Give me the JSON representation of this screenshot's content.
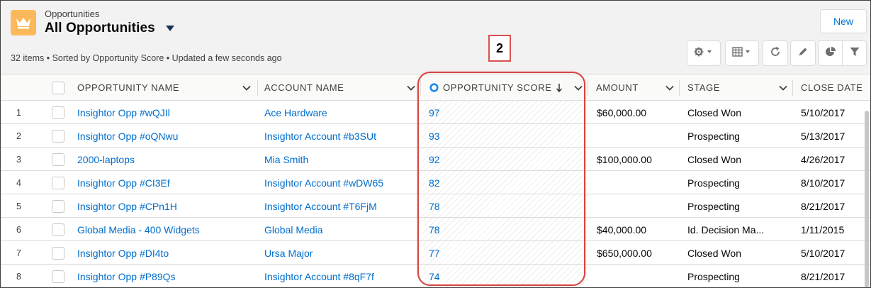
{
  "header": {
    "object_label": "Opportunities",
    "list_title": "All Opportunities",
    "new_button": "New",
    "meta": "32 items • Sorted by Opportunity Score • Updated a few seconds ago",
    "callout": "2"
  },
  "toolbar": {
    "icons": [
      "gear-icon",
      "table-icon",
      "refresh-icon",
      "pencil-icon",
      "pie-chart-icon",
      "filter-icon"
    ]
  },
  "columns": {
    "name": "Opportunity Name",
    "account": "Account Name",
    "score": "Opportunity Score",
    "amount": "Amount",
    "stage": "Stage",
    "close": "Close Date"
  },
  "rows": [
    {
      "num": "1",
      "name": "Insightor Opp #wQJIl",
      "account": "Ace Hardware",
      "score": "97",
      "amount": "$60,000.00",
      "stage": "Closed Won",
      "close": "5/10/2017"
    },
    {
      "num": "2",
      "name": "Insightor Opp #oQNwu",
      "account": "Insightor Account #b3SUt",
      "score": "93",
      "amount": "",
      "stage": "Prospecting",
      "close": "5/13/2017"
    },
    {
      "num": "3",
      "name": "2000-laptops",
      "account": "Mia Smith",
      "score": "92",
      "amount": "$100,000.00",
      "stage": "Closed Won",
      "close": "4/26/2017"
    },
    {
      "num": "4",
      "name": "Insightor Opp #CI3Ef",
      "account": "Insightor Account #wDW65",
      "score": "82",
      "amount": "",
      "stage": "Prospecting",
      "close": "8/10/2017"
    },
    {
      "num": "5",
      "name": "Insightor Opp #CPn1H",
      "account": "Insightor Account #T6FjM",
      "score": "78",
      "amount": "",
      "stage": "Prospecting",
      "close": "8/21/2017"
    },
    {
      "num": "6",
      "name": "Global Media - 400 Widgets",
      "account": "Global Media",
      "score": "78",
      "amount": "$40,000.00",
      "stage": "Id. Decision Ma...",
      "close": "1/11/2015"
    },
    {
      "num": "7",
      "name": "Insightor Opp #DI4to",
      "account": "Ursa Major",
      "score": "77",
      "amount": "$650,000.00",
      "stage": "Closed Won",
      "close": "5/10/2017"
    },
    {
      "num": "8",
      "name": "Insightor Opp #P89Qs",
      "account": "Insightor Account #8qF7f",
      "score": "74",
      "amount": "",
      "stage": "Prospecting",
      "close": "8/21/2017"
    }
  ],
  "colors": {
    "link": "#006dcc",
    "app_icon": "#fcb95b",
    "highlight": "#d64541",
    "score_indicator": "#1589ee"
  }
}
